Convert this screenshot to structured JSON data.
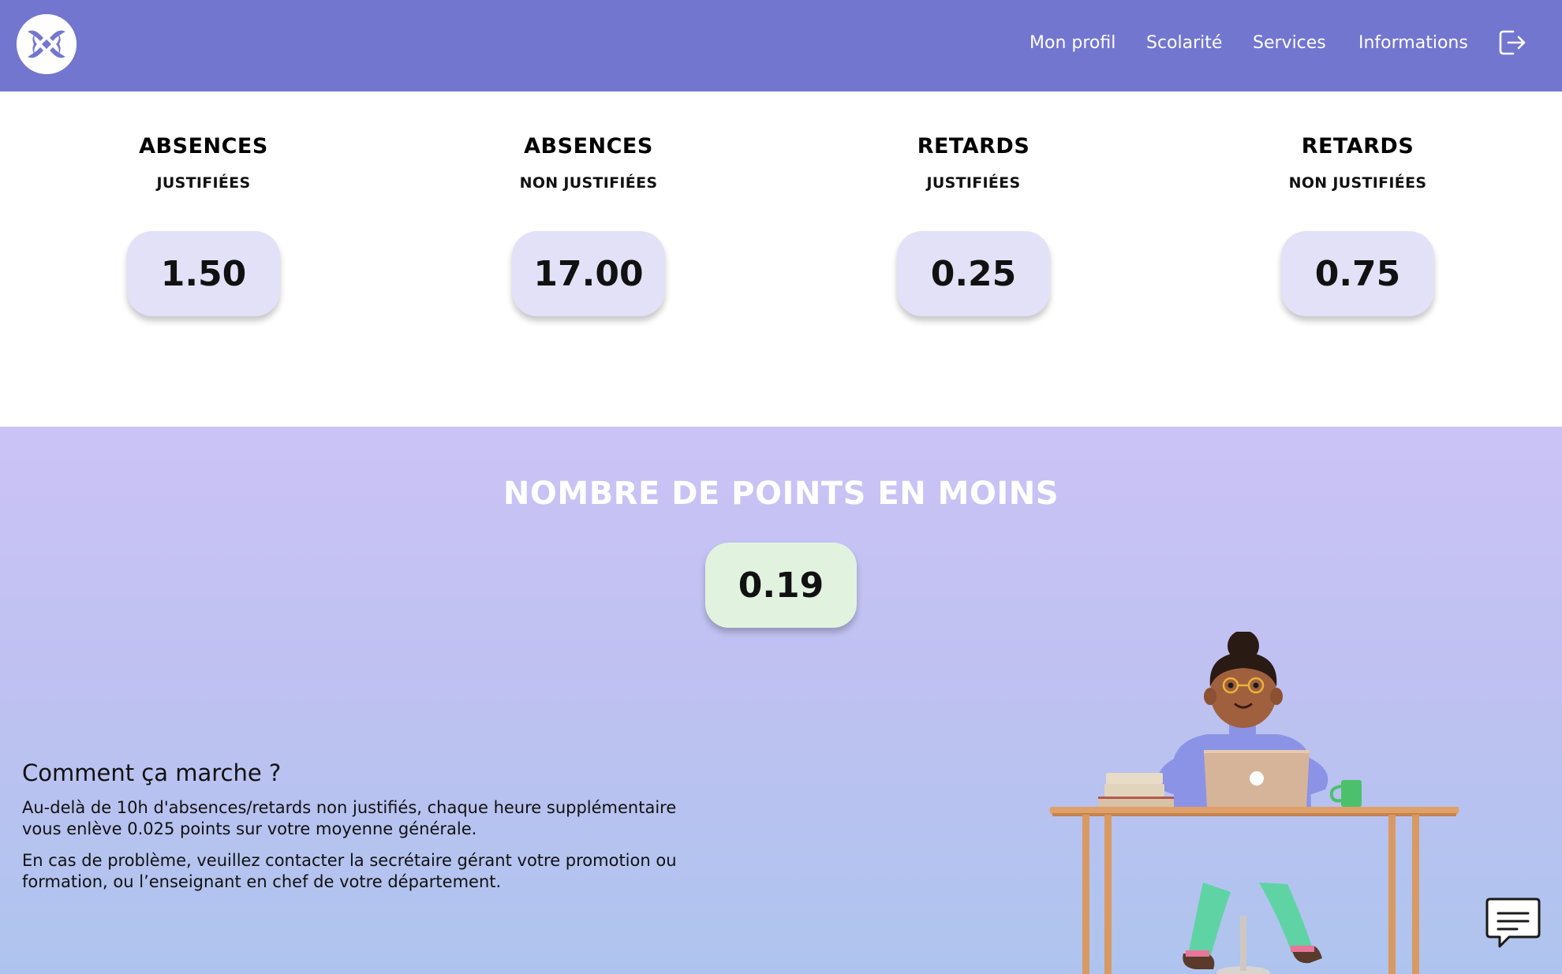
{
  "header": {
    "logo_icon": "app-logo-icon",
    "nav": [
      "Mon profil",
      "Scolarité",
      "Services",
      "Informations"
    ],
    "logout_icon": "logout-icon",
    "background_color": "#7276cf"
  },
  "stats": [
    {
      "title": "ABSENCES",
      "subtitle": "JUSTIFIÉES",
      "value": "1.50"
    },
    {
      "title": "ABSENCES",
      "subtitle": "NON JUSTIFIÉES",
      "value": "17.00"
    },
    {
      "title": "RETARDS",
      "subtitle": "JUSTIFIÉES",
      "value": "0.25"
    },
    {
      "title": "RETARDS",
      "subtitle": "NON JUSTIFIÉES",
      "value": "0.75"
    }
  ],
  "malus": {
    "title": "NOMBRE DE POINTS EN MOINS",
    "value": "0.19"
  },
  "howto": {
    "title": "Comment ça marche ?",
    "paragraph1": "Au-delà de 10h d'absences/retards non justifiés, chaque heure supplémentaire vous enlève 0.025 points sur votre moyenne générale.",
    "paragraph2": "En cas de problème, veuillez contacter la secrétaire gérant votre promotion ou formation, ou l’enseignant en chef de votre département."
  },
  "chat_icon": "chat-bubble-icon"
}
